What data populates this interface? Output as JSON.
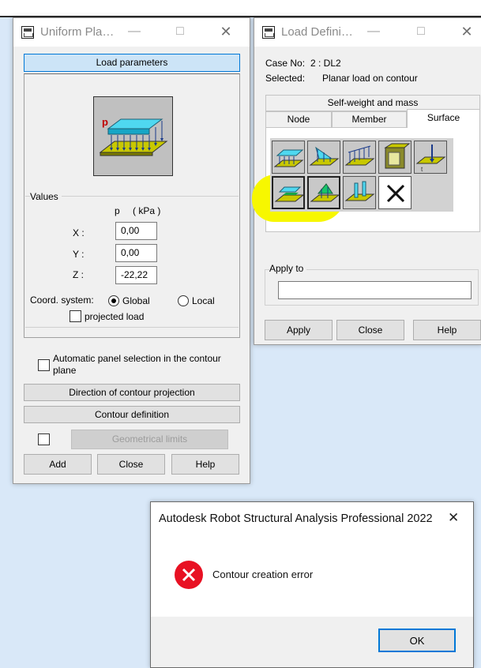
{
  "uniform_dialog": {
    "title": "Uniform Pla…",
    "load_parameters_label": "Load parameters",
    "image_letter": "p",
    "values_label": "Values",
    "p_header": "p",
    "unit_header": "( kPa )",
    "x_label": "X :",
    "y_label": "Y :",
    "z_label": "Z :",
    "x_value": "0,00",
    "y_value": "0,00",
    "z_value": "-22,22",
    "coord_label": "Coord. system:",
    "global_label": "Global",
    "local_label": "Local",
    "coord_selected": "Global",
    "projected_label": "projected load",
    "auto_panel_label": "Automatic panel selection in the contour plane",
    "direction_label": "Direction of contour projection",
    "contour_def_label": "Contour definition",
    "geom_limits_label": "Geometrical limits",
    "add_label": "Add",
    "close_label": "Close",
    "help_label": "Help"
  },
  "load_def_dialog": {
    "title": "Load Defini…",
    "case_label": "Case No:",
    "case_value": "2 : DL2",
    "selected_label": "Selected:",
    "selected_value": "Planar load on contour",
    "top_tab": "Self-weight and mass",
    "tabs": [
      "Node",
      "Member",
      "Surface"
    ],
    "active_tab": "Surface",
    "tools": [
      {
        "icon": "uniform-planar-load-icon"
      },
      {
        "icon": "linear-planar-load-icon"
      },
      {
        "icon": "edge-load-icon"
      },
      {
        "icon": "hydrostatic-load-icon"
      },
      {
        "icon": "point-load-on-panel-icon"
      },
      {
        "icon": "planar-load-on-contour-icon"
      },
      {
        "icon": "linear-load-on-contour-icon"
      },
      {
        "icon": "linear-load-2p-icon"
      },
      {
        "icon": "delete-load-icon"
      }
    ],
    "apply_to_label": "Apply to",
    "apply_to_value": "",
    "apply_label": "Apply",
    "close_label": "Close",
    "help_label": "Help"
  },
  "error_dialog": {
    "title": "Autodesk Robot Structural Analysis Professional 2022",
    "message": "Contour creation error",
    "ok_label": "OK",
    "close_glyph": "✕"
  },
  "colors": {
    "highlight": "#f7f700",
    "error_red": "#e81123",
    "accent_blue": "#0078d7"
  }
}
